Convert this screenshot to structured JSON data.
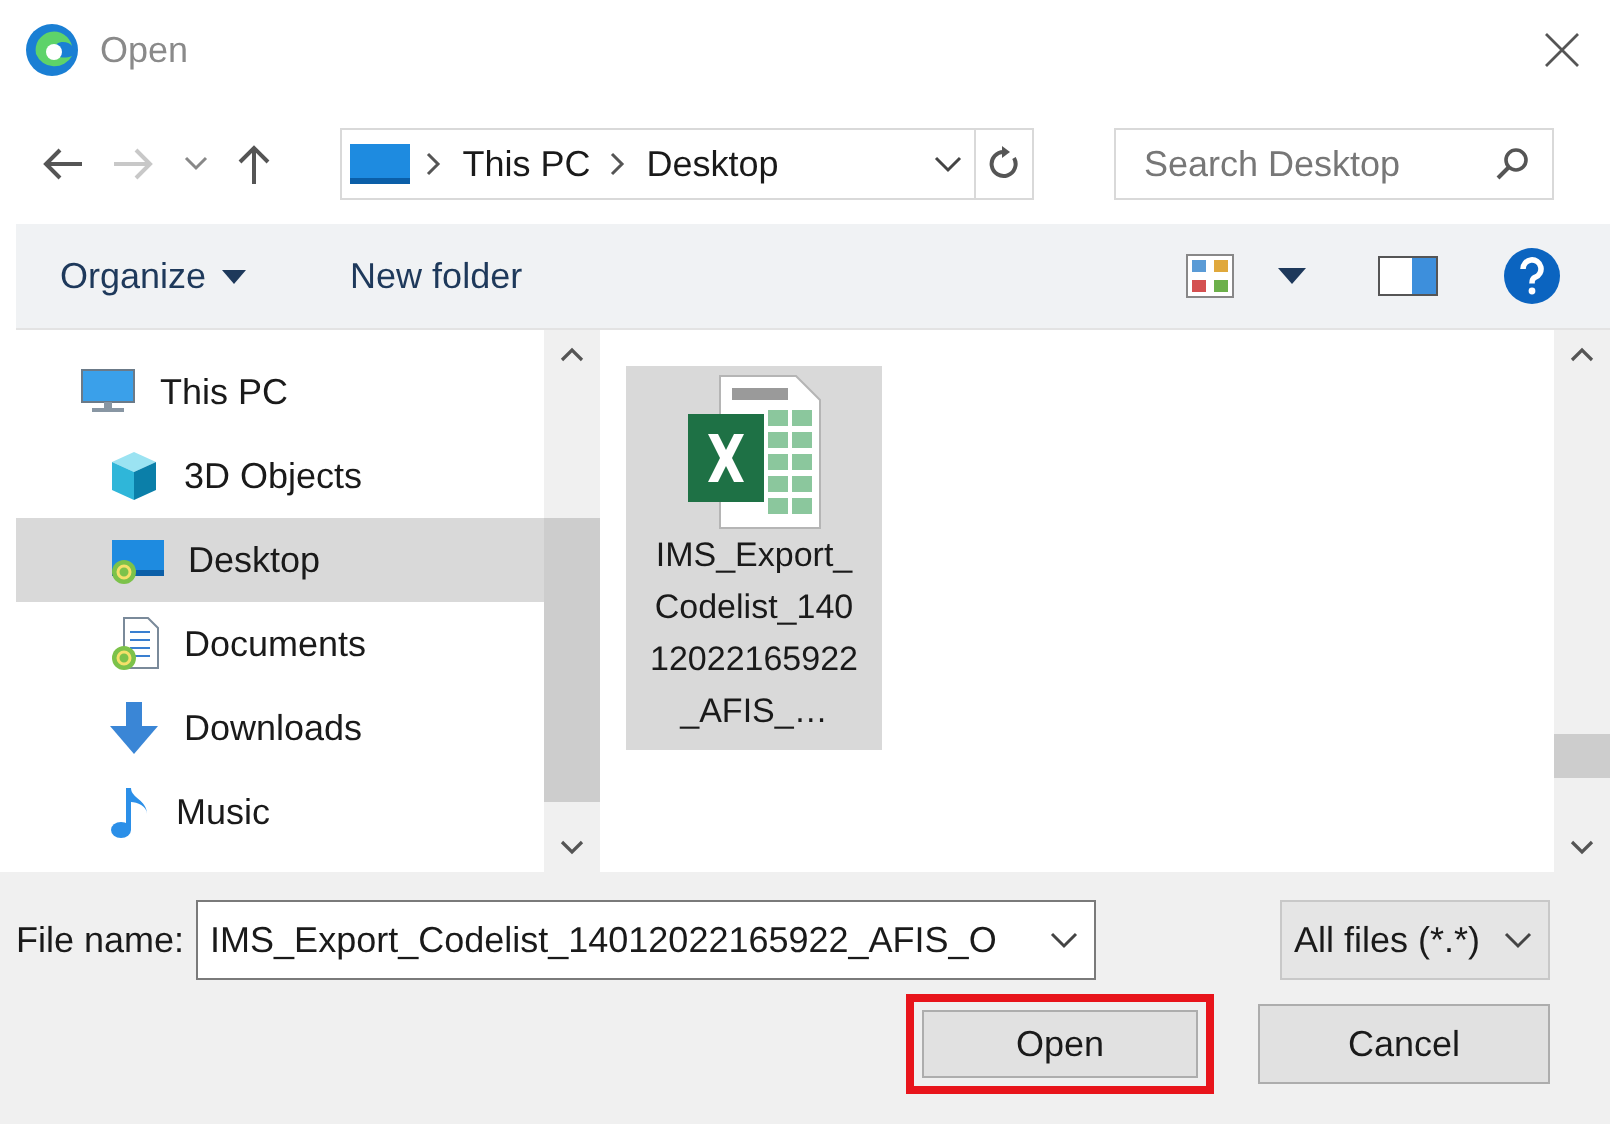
{
  "window": {
    "title": "Open"
  },
  "address": {
    "path": [
      "This PC",
      "Desktop"
    ]
  },
  "search": {
    "placeholder": "Search Desktop"
  },
  "toolbar": {
    "items": [
      {
        "label": "Organize",
        "kind": "menu"
      },
      {
        "label": "New folder",
        "kind": "action"
      }
    ]
  },
  "sidebar": {
    "items": [
      {
        "label": "This PC",
        "kind": "computer",
        "selected": false,
        "children": [
          {
            "label": "3D Objects",
            "kind": "cube",
            "selected": false
          },
          {
            "label": "Desktop",
            "kind": "desktop",
            "selected": true
          },
          {
            "label": "Documents",
            "kind": "documents",
            "selected": false
          },
          {
            "label": "Downloads",
            "kind": "downloads",
            "selected": false
          },
          {
            "label": "Music",
            "kind": "music",
            "selected": false
          }
        ]
      }
    ]
  },
  "files": [
    {
      "name": "IMS_Export_Codelist_14012022165922_AFIS_…",
      "kind": "spreadsheet",
      "selected": true
    }
  ],
  "file_name": {
    "label": "File name:",
    "value": "IMS_Export_Codelist_14012022165922_AFIS_O"
  },
  "file_type": {
    "value": "All files (*.*)"
  },
  "buttons": [
    {
      "label": "Open",
      "highlighted": true
    },
    {
      "label": "Cancel",
      "highlighted": false
    }
  ]
}
